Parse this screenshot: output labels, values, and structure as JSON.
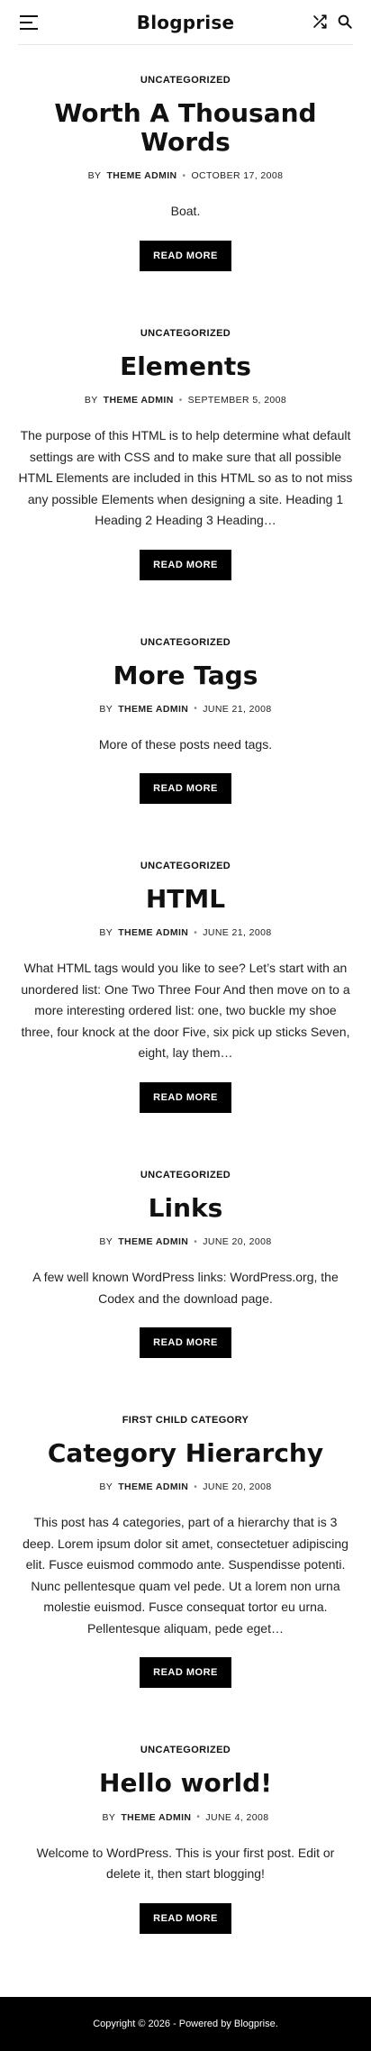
{
  "header": {
    "site_title": "Blogprise",
    "menu_icon": "hamburger-menu-icon",
    "shuffle_icon": "shuffle-icon",
    "search_icon": "search-icon"
  },
  "posts": [
    {
      "category": "UNCATEGORIZED",
      "title": "Worth A Thousand Words",
      "by": "BY",
      "author": "THEME ADMIN",
      "date": "OCTOBER 17, 2008",
      "excerpt": "Boat.",
      "button": "READ MORE"
    },
    {
      "category": "UNCATEGORIZED",
      "title": "Elements",
      "by": "BY",
      "author": "THEME ADMIN",
      "date": "SEPTEMBER 5, 2008",
      "excerpt": "The purpose of this HTML is to help determine what default settings are with CSS and to make sure that all possible HTML Elements are included in this HTML so as to not miss any possible Elements when designing a site. Heading 1 Heading 2 Heading 3 Heading…",
      "button": "READ MORE"
    },
    {
      "category": "UNCATEGORIZED",
      "title": "More Tags",
      "by": "BY",
      "author": "THEME ADMIN",
      "date": "JUNE 21, 2008",
      "excerpt": "More of these posts need tags.",
      "button": "READ MORE"
    },
    {
      "category": "UNCATEGORIZED",
      "title": "HTML",
      "by": "BY",
      "author": "THEME ADMIN",
      "date": "JUNE 21, 2008",
      "excerpt": "What HTML tags would you like to see? Let’s start with an unordered list: One Two Three Four And then move on to a more interesting ordered list: one, two buckle my shoe three, four knock at the door Five, six pick up sticks Seven, eight, lay them…",
      "button": "READ MORE"
    },
    {
      "category": "UNCATEGORIZED",
      "title": "Links",
      "by": "BY",
      "author": "THEME ADMIN",
      "date": "JUNE 20, 2008",
      "excerpt": "A few well known WordPress links: WordPress.org, the Codex and the download page.",
      "button": "READ MORE"
    },
    {
      "category": "FIRST CHILD CATEGORY",
      "title": "Category Hierarchy",
      "by": "BY",
      "author": "THEME ADMIN",
      "date": "JUNE 20, 2008",
      "excerpt": "This post has 4 categories, part of a hierarchy that is 3 deep. Lorem ipsum dolor sit amet, consectetuer adipiscing elit. Fusce euismod commodo ante. Suspendisse potenti. Nunc pellentesque quam vel pede. Ut a lorem non urna molestie euismod. Fusce consequat tortor eu urna. Pellentesque aliquam, pede eget…",
      "button": "READ MORE"
    },
    {
      "category": "UNCATEGORIZED",
      "title": "Hello world!",
      "by": "BY",
      "author": "THEME ADMIN",
      "date": "JUNE 4, 2008",
      "excerpt": "Welcome to WordPress. This is your first post. Edit or delete it, then start blogging!",
      "button": "READ MORE"
    }
  ],
  "footer": {
    "text": "Copyright © 2026 - Powered by Blogprise."
  }
}
